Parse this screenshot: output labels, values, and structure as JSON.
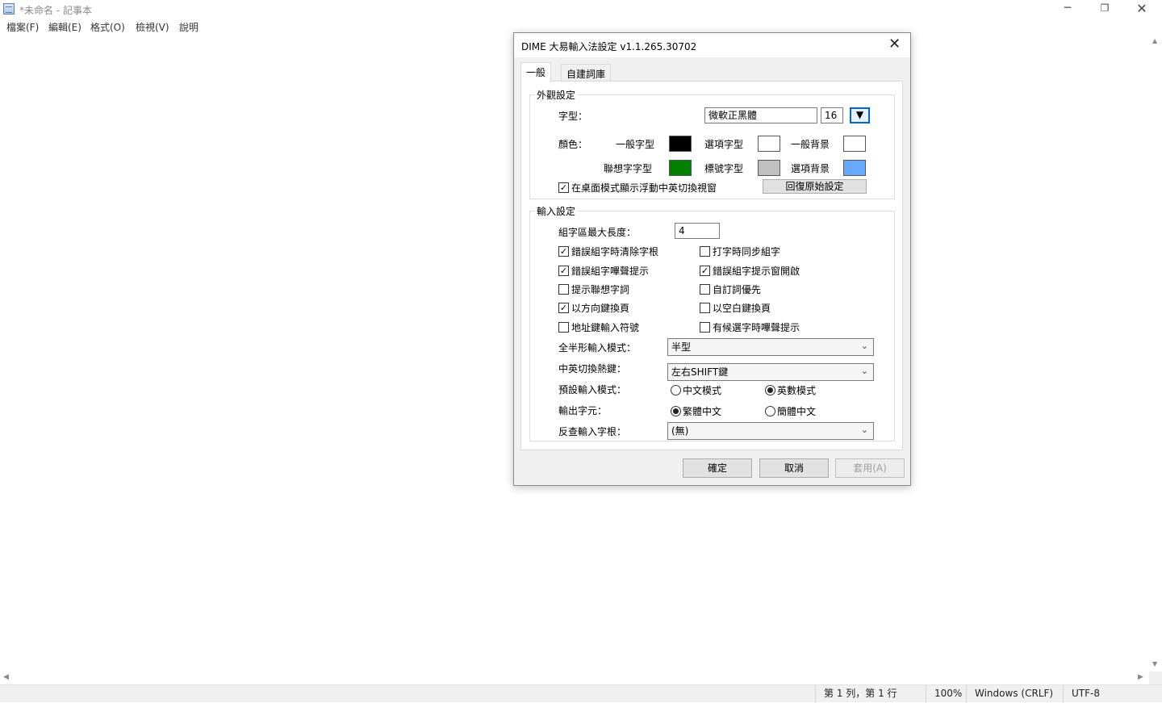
{
  "window": {
    "title": "*未命名 - 記事本",
    "min_icon": "─",
    "restore_icon": "❐",
    "close_icon": "✕"
  },
  "menu": [
    "檔案(F)",
    "編輯(E)",
    "格式(O)",
    "檢視(V)",
    "說明"
  ],
  "status": {
    "position": "第 1 列，第 1 行",
    "zoom": "100%",
    "line_ending": "Windows (CRLF)",
    "encoding": "UTF-8"
  },
  "dialog": {
    "title": "DIME 大易輸入法設定 v1.1.265.30702",
    "close_icon": "✕",
    "tabs": [
      "一般",
      "自建詞庫"
    ],
    "appearance": {
      "legend": "外觀設定",
      "font_label": "字型：",
      "font_name": "微軟正黑體",
      "font_size": "16",
      "font_picker_icon": "▼",
      "color_label": "顏色：",
      "colors": [
        {
          "label": "一般字型",
          "color": "#000000"
        },
        {
          "label": "選項字型",
          "color": "#ffffff"
        },
        {
          "label": "一般背景",
          "color": "#ffffff"
        },
        {
          "label": "聯想字字型",
          "color": "#008000"
        },
        {
          "label": "標號字型",
          "color": "#c0c0c0"
        },
        {
          "label": "選項背景",
          "color": "#66aaff"
        }
      ],
      "floating_window_label": "在桌面模式顯示浮動中英切換視窗",
      "floating_window_checked": true,
      "restore_defaults_button": "回復原始設定"
    },
    "input": {
      "legend": "輸入設定",
      "max_length_label": "組字區最大長度：",
      "max_length_value": "4",
      "options": [
        {
          "label": "錯誤組字時清除字根",
          "checked": true
        },
        {
          "label": "打字時同步組字",
          "checked": false
        },
        {
          "label": "錯誤組字嗶聲提示",
          "checked": true
        },
        {
          "label": "錯誤組字提示窗開啟",
          "checked": true
        },
        {
          "label": "提示聯想字詞",
          "checked": false
        },
        {
          "label": "自訂詞優先",
          "checked": false
        },
        {
          "label": "以方向鍵換頁",
          "checked": true
        },
        {
          "label": "以空白鍵換頁",
          "checked": false
        },
        {
          "label": "地址鍵輸入符號",
          "checked": false
        },
        {
          "label": "有候選字時嗶聲提示",
          "checked": false
        }
      ],
      "width_mode_label": "全半形輸入模式：",
      "width_mode_value": "半型",
      "toggle_key_label": "中英切換熱鍵：",
      "toggle_key_value": "左右SHIFT鍵",
      "default_mode_label": "預設輸入模式：",
      "default_mode_options": [
        "中文模式",
        "英數模式"
      ],
      "default_mode_selected": "英數模式",
      "output_label": "輸出字元：",
      "output_options": [
        "繁體中文",
        "簡體中文"
      ],
      "output_selected": "繁體中文",
      "reverse_lookup_label": "反查輸入字根：",
      "reverse_lookup_value": "(無)"
    },
    "buttons": {
      "ok": "確定",
      "cancel": "取消",
      "apply": "套用(A)"
    }
  }
}
